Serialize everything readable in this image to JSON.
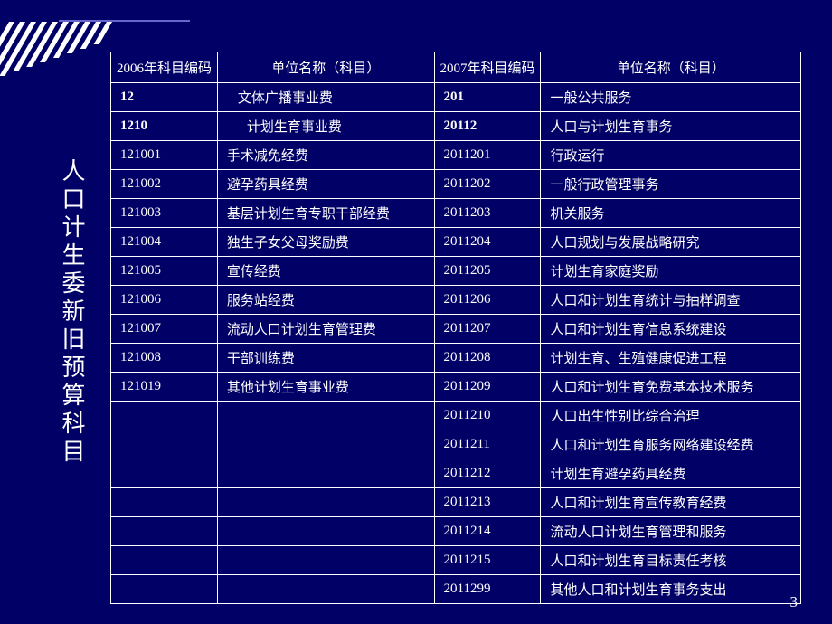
{
  "title": "人口计生委新旧预算科目",
  "page_number": "3",
  "headers": {
    "code_2006": "2006年科目编码",
    "name_2006": "单位名称（科目）",
    "code_2007": "2007年科目编码",
    "name_2007": "单位名称（科目）"
  },
  "rows": [
    {
      "c1": "12",
      "n1": "文体广播事业费",
      "n1_indent": 1,
      "b1": true,
      "c2": "201",
      "n2": "一般公共服务",
      "b2": true
    },
    {
      "c1": "1210",
      "n1": "计划生育事业费",
      "n1_indent": 2,
      "b1": true,
      "c2": "20112",
      "n2": "人口与计划生育事务",
      "b2": true
    },
    {
      "c1": "121001",
      "n1": "手术减免经费",
      "n1_indent": 0,
      "b1": false,
      "c2": "2011201",
      "n2": "行政运行",
      "b2": false
    },
    {
      "c1": "121002",
      "n1": "避孕药具经费",
      "n1_indent": 0,
      "b1": false,
      "c2": "2011202",
      "n2": "一般行政管理事务",
      "b2": false
    },
    {
      "c1": "121003",
      "n1": "基层计划生育专职干部经费",
      "n1_indent": 0,
      "b1": false,
      "c2": "2011203",
      "n2": "机关服务",
      "b2": false
    },
    {
      "c1": "121004",
      "n1": "独生子女父母奖励费",
      "n1_indent": 0,
      "b1": false,
      "c2": "2011204",
      "n2": "人口规划与发展战略研究",
      "b2": false
    },
    {
      "c1": "121005",
      "n1": "宣传经费",
      "n1_indent": 0,
      "b1": false,
      "c2": "2011205",
      "n2": "计划生育家庭奖励",
      "b2": false
    },
    {
      "c1": "121006",
      "n1": "服务站经费",
      "n1_indent": 0,
      "b1": false,
      "c2": "2011206",
      "n2": "人口和计划生育统计与抽样调查",
      "b2": false
    },
    {
      "c1": "121007",
      "n1": "流动人口计划生育管理费",
      "n1_indent": 0,
      "b1": false,
      "c2": "2011207",
      "n2": "人口和计划生育信息系统建设",
      "b2": false
    },
    {
      "c1": "121008",
      "n1": "干部训练费",
      "n1_indent": 0,
      "b1": false,
      "c2": "2011208",
      "n2": "计划生育、生殖健康促进工程",
      "b2": false
    },
    {
      "c1": "121019",
      "n1": "其他计划生育事业费",
      "n1_indent": 0,
      "b1": false,
      "c2": "2011209",
      "n2": "人口和计划生育免费基本技术服务",
      "b2": false
    },
    {
      "c1": "",
      "n1": "",
      "n1_indent": 0,
      "b1": false,
      "c2": "2011210",
      "n2": "人口出生性别比综合治理",
      "b2": false
    },
    {
      "c1": "",
      "n1": "",
      "n1_indent": 0,
      "b1": false,
      "c2": "2011211",
      "n2": "人口和计划生育服务网络建设经费",
      "b2": false
    },
    {
      "c1": "",
      "n1": "",
      "n1_indent": 0,
      "b1": false,
      "c2": "2011212",
      "n2": "计划生育避孕药具经费",
      "b2": false
    },
    {
      "c1": "",
      "n1": "",
      "n1_indent": 0,
      "b1": false,
      "c2": "2011213",
      "n2": "人口和计划生育宣传教育经费",
      "b2": false
    },
    {
      "c1": "",
      "n1": "",
      "n1_indent": 0,
      "b1": false,
      "c2": "2011214",
      "n2": "流动人口计划生育管理和服务",
      "b2": false
    },
    {
      "c1": "",
      "n1": "",
      "n1_indent": 0,
      "b1": false,
      "c2": "2011215",
      "n2": "人口和计划生育目标责任考核",
      "b2": false
    },
    {
      "c1": "",
      "n1": "",
      "n1_indent": 0,
      "b1": false,
      "c2": "2011299",
      "n2": "其他人口和计划生育事务支出",
      "b2": false
    }
  ]
}
